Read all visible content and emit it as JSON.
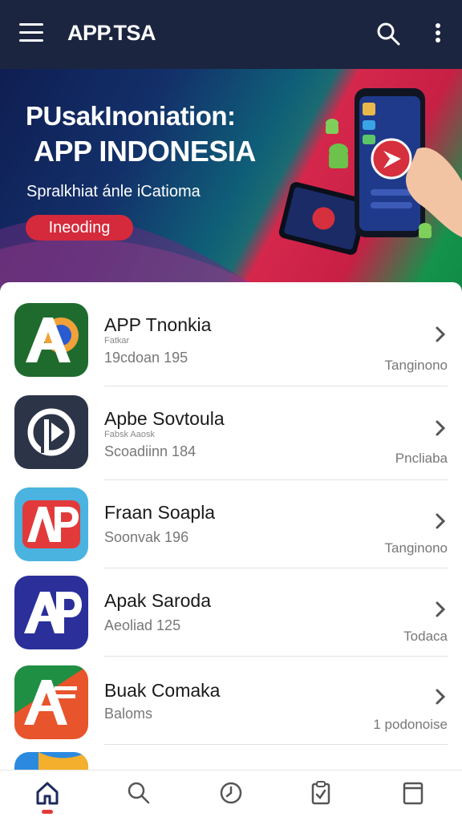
{
  "header": {
    "title": "APP.TSA",
    "menu_icon": "hamburger-menu-icon",
    "search_icon": "search-icon",
    "more_icon": "more-vertical-icon"
  },
  "banner": {
    "line1": "PUsakInoniation:",
    "line2": "APP INDONESIA",
    "subtitle": "Spralkhiat ánle iCatioma",
    "cta_label": "Ineoding"
  },
  "apps": [
    {
      "title": "APP Tnonkia",
      "small": "Fatkar",
      "meta": "19cdoan 195",
      "right": "Tanginono",
      "icon": "ap-green-orange-icon"
    },
    {
      "title": "Apbe Sovtoula",
      "small": "Fabsk Aaosk",
      "meta": "Scoadiinn 184",
      "right": "Pncliaba",
      "icon": "play-circle-icon"
    },
    {
      "title": "Fraan Soapla",
      "small": "",
      "meta": "Soonvak 196",
      "right": "Tanginono",
      "icon": "ap-red-blue-icon"
    },
    {
      "title": "Apak Saroda",
      "small": "",
      "meta": "Aeoliad 125",
      "right": "Todaca",
      "icon": "ap-purple-icon"
    },
    {
      "title": "Buak Comaka",
      "small": "",
      "meta": "Baloms",
      "right": "1 podonoise",
      "icon": "a-flag-icon"
    }
  ],
  "nav": {
    "items": [
      "home-icon",
      "search-icon",
      "clock-icon",
      "clipboard-icon",
      "book-icon"
    ],
    "active": "home-icon"
  },
  "colors": {
    "header_bg": "#1b2540",
    "accent_red": "#d42a3c"
  }
}
